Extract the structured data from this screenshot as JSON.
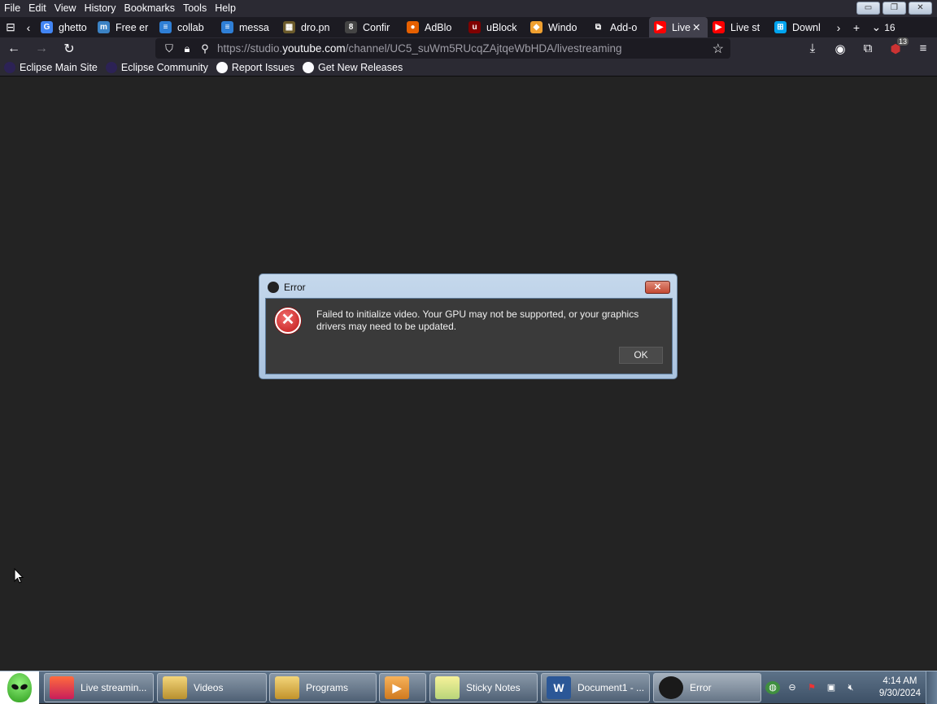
{
  "menubar": {
    "items": [
      "File",
      "Edit",
      "View",
      "History",
      "Bookmarks",
      "Tools",
      "Help"
    ]
  },
  "tabs": [
    {
      "label": "ghetto",
      "icon": "google-icon",
      "color": "#4285f4",
      "glyph": "G"
    },
    {
      "label": "Free er",
      "icon": "m-icon",
      "color": "#3b82c4",
      "glyph": "m"
    },
    {
      "label": "collab",
      "icon": "doc-icon",
      "color": "#2f7fd6",
      "glyph": "≡"
    },
    {
      "label": "messa",
      "icon": "doc-icon",
      "color": "#2f7fd6",
      "glyph": "≡"
    },
    {
      "label": "dro.pn",
      "icon": "image-icon",
      "color": "#6b5a2a",
      "glyph": "▦"
    },
    {
      "label": "Confir",
      "icon": "eight-icon",
      "color": "#444444",
      "glyph": "8"
    },
    {
      "label": "AdBlo",
      "icon": "firefox-icon",
      "color": "#e66000",
      "glyph": "●"
    },
    {
      "label": "uBlock",
      "icon": "ublock-icon",
      "color": "#800000",
      "glyph": "u"
    },
    {
      "label": "Windo",
      "icon": "diamond-icon",
      "color": "#f0a030",
      "glyph": "◆"
    },
    {
      "label": "Add-o",
      "icon": "puzzle-icon",
      "color": "#1c1b22",
      "glyph": "⧉"
    },
    {
      "label": "Live",
      "icon": "youtube-icon",
      "color": "#ff0000",
      "glyph": "▶",
      "active": true
    },
    {
      "label": "Live st",
      "icon": "youtube-icon",
      "color": "#ff0000",
      "glyph": "▶"
    },
    {
      "label": "Downl",
      "icon": "windows-icon",
      "color": "#00a4ef",
      "glyph": "⊞"
    }
  ],
  "tab_count": "16",
  "url": {
    "prefix": "https://studio.",
    "domain": "youtube.com",
    "path": "/channel/UC5_suWm5RUcqZAjtqeWbHDA/livestreaming"
  },
  "ublock_badge": "13",
  "bookmarks": [
    {
      "label": "Eclipse Main Site",
      "icon": "eclipse-icon"
    },
    {
      "label": "Eclipse Community",
      "icon": "eclipse-icon"
    },
    {
      "label": "Report Issues",
      "icon": "github-icon"
    },
    {
      "label": "Get New Releases",
      "icon": "github-icon"
    }
  ],
  "dialog": {
    "title": "Error",
    "message": "Failed to initialize video.  Your GPU may not be supported, or your graphics drivers may need to be updated.",
    "ok_label": "OK"
  },
  "taskbar": {
    "buttons": [
      {
        "label": "Live streamin...",
        "icon": "firefox-icon"
      },
      {
        "label": "Videos",
        "icon": "videos-folder-icon"
      },
      {
        "label": "Programs",
        "icon": "programs-folder-icon"
      },
      {
        "label": "",
        "icon": "media-player-icon"
      },
      {
        "label": "Sticky Notes",
        "icon": "sticky-notes-icon"
      },
      {
        "label": "Document1 - ...",
        "icon": "word-icon"
      },
      {
        "label": "Error",
        "icon": "obs-icon"
      }
    ],
    "time": "4:14 AM",
    "date": "9/30/2024"
  }
}
